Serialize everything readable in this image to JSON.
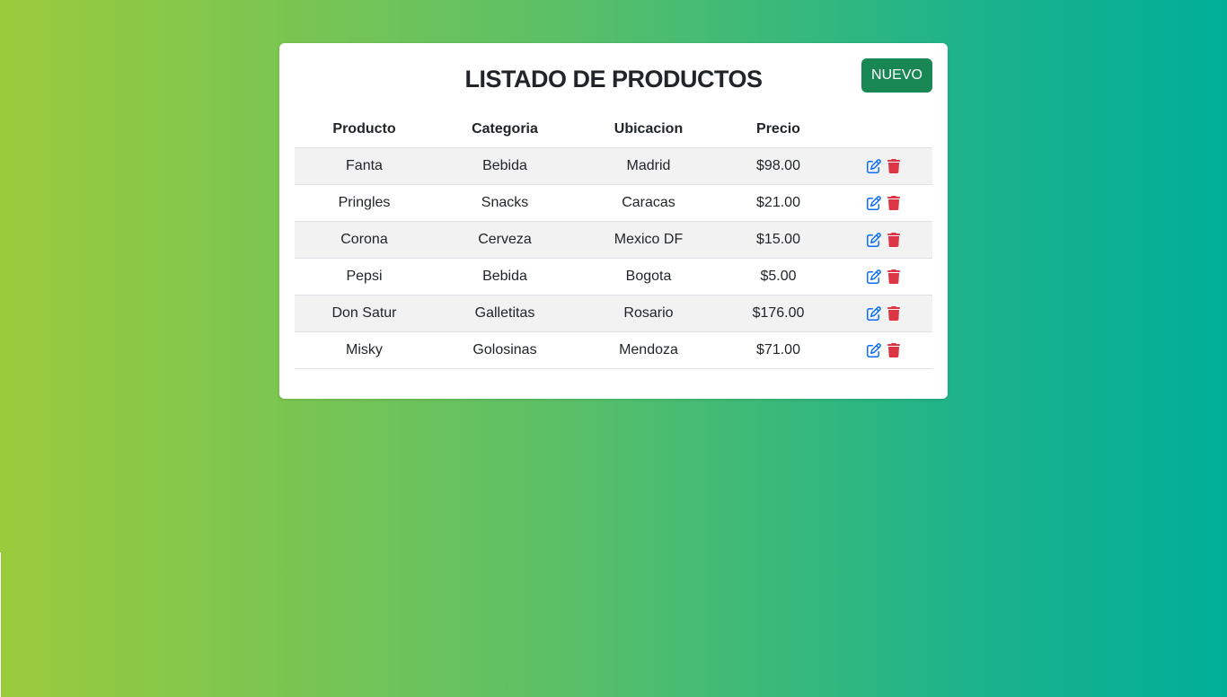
{
  "title": "LISTADO DE PRODUCTOS",
  "new_button_label": "NUEVO",
  "colors": {
    "accent_green": "#198754",
    "edit_blue": "#0d6efd",
    "delete_red": "#dc3545"
  },
  "table": {
    "headers": [
      "Producto",
      "Categoria",
      "Ubicacion",
      "Precio",
      ""
    ],
    "rows": [
      {
        "producto": "Fanta",
        "categoria": "Bebida",
        "ubicacion": "Madrid",
        "precio": "$98.00"
      },
      {
        "producto": "Pringles",
        "categoria": "Snacks",
        "ubicacion": "Caracas",
        "precio": "$21.00"
      },
      {
        "producto": "Corona",
        "categoria": "Cerveza",
        "ubicacion": "Mexico DF",
        "precio": "$15.00"
      },
      {
        "producto": "Pepsi",
        "categoria": "Bebida",
        "ubicacion": "Bogota",
        "precio": "$5.00"
      },
      {
        "producto": "Don Satur",
        "categoria": "Galletitas",
        "ubicacion": "Rosario",
        "precio": "$176.00"
      },
      {
        "producto": "Misky",
        "categoria": "Golosinas",
        "ubicacion": "Mendoza",
        "precio": "$71.00"
      }
    ],
    "row_actions": [
      "edit-icon",
      "trash-icon"
    ]
  }
}
